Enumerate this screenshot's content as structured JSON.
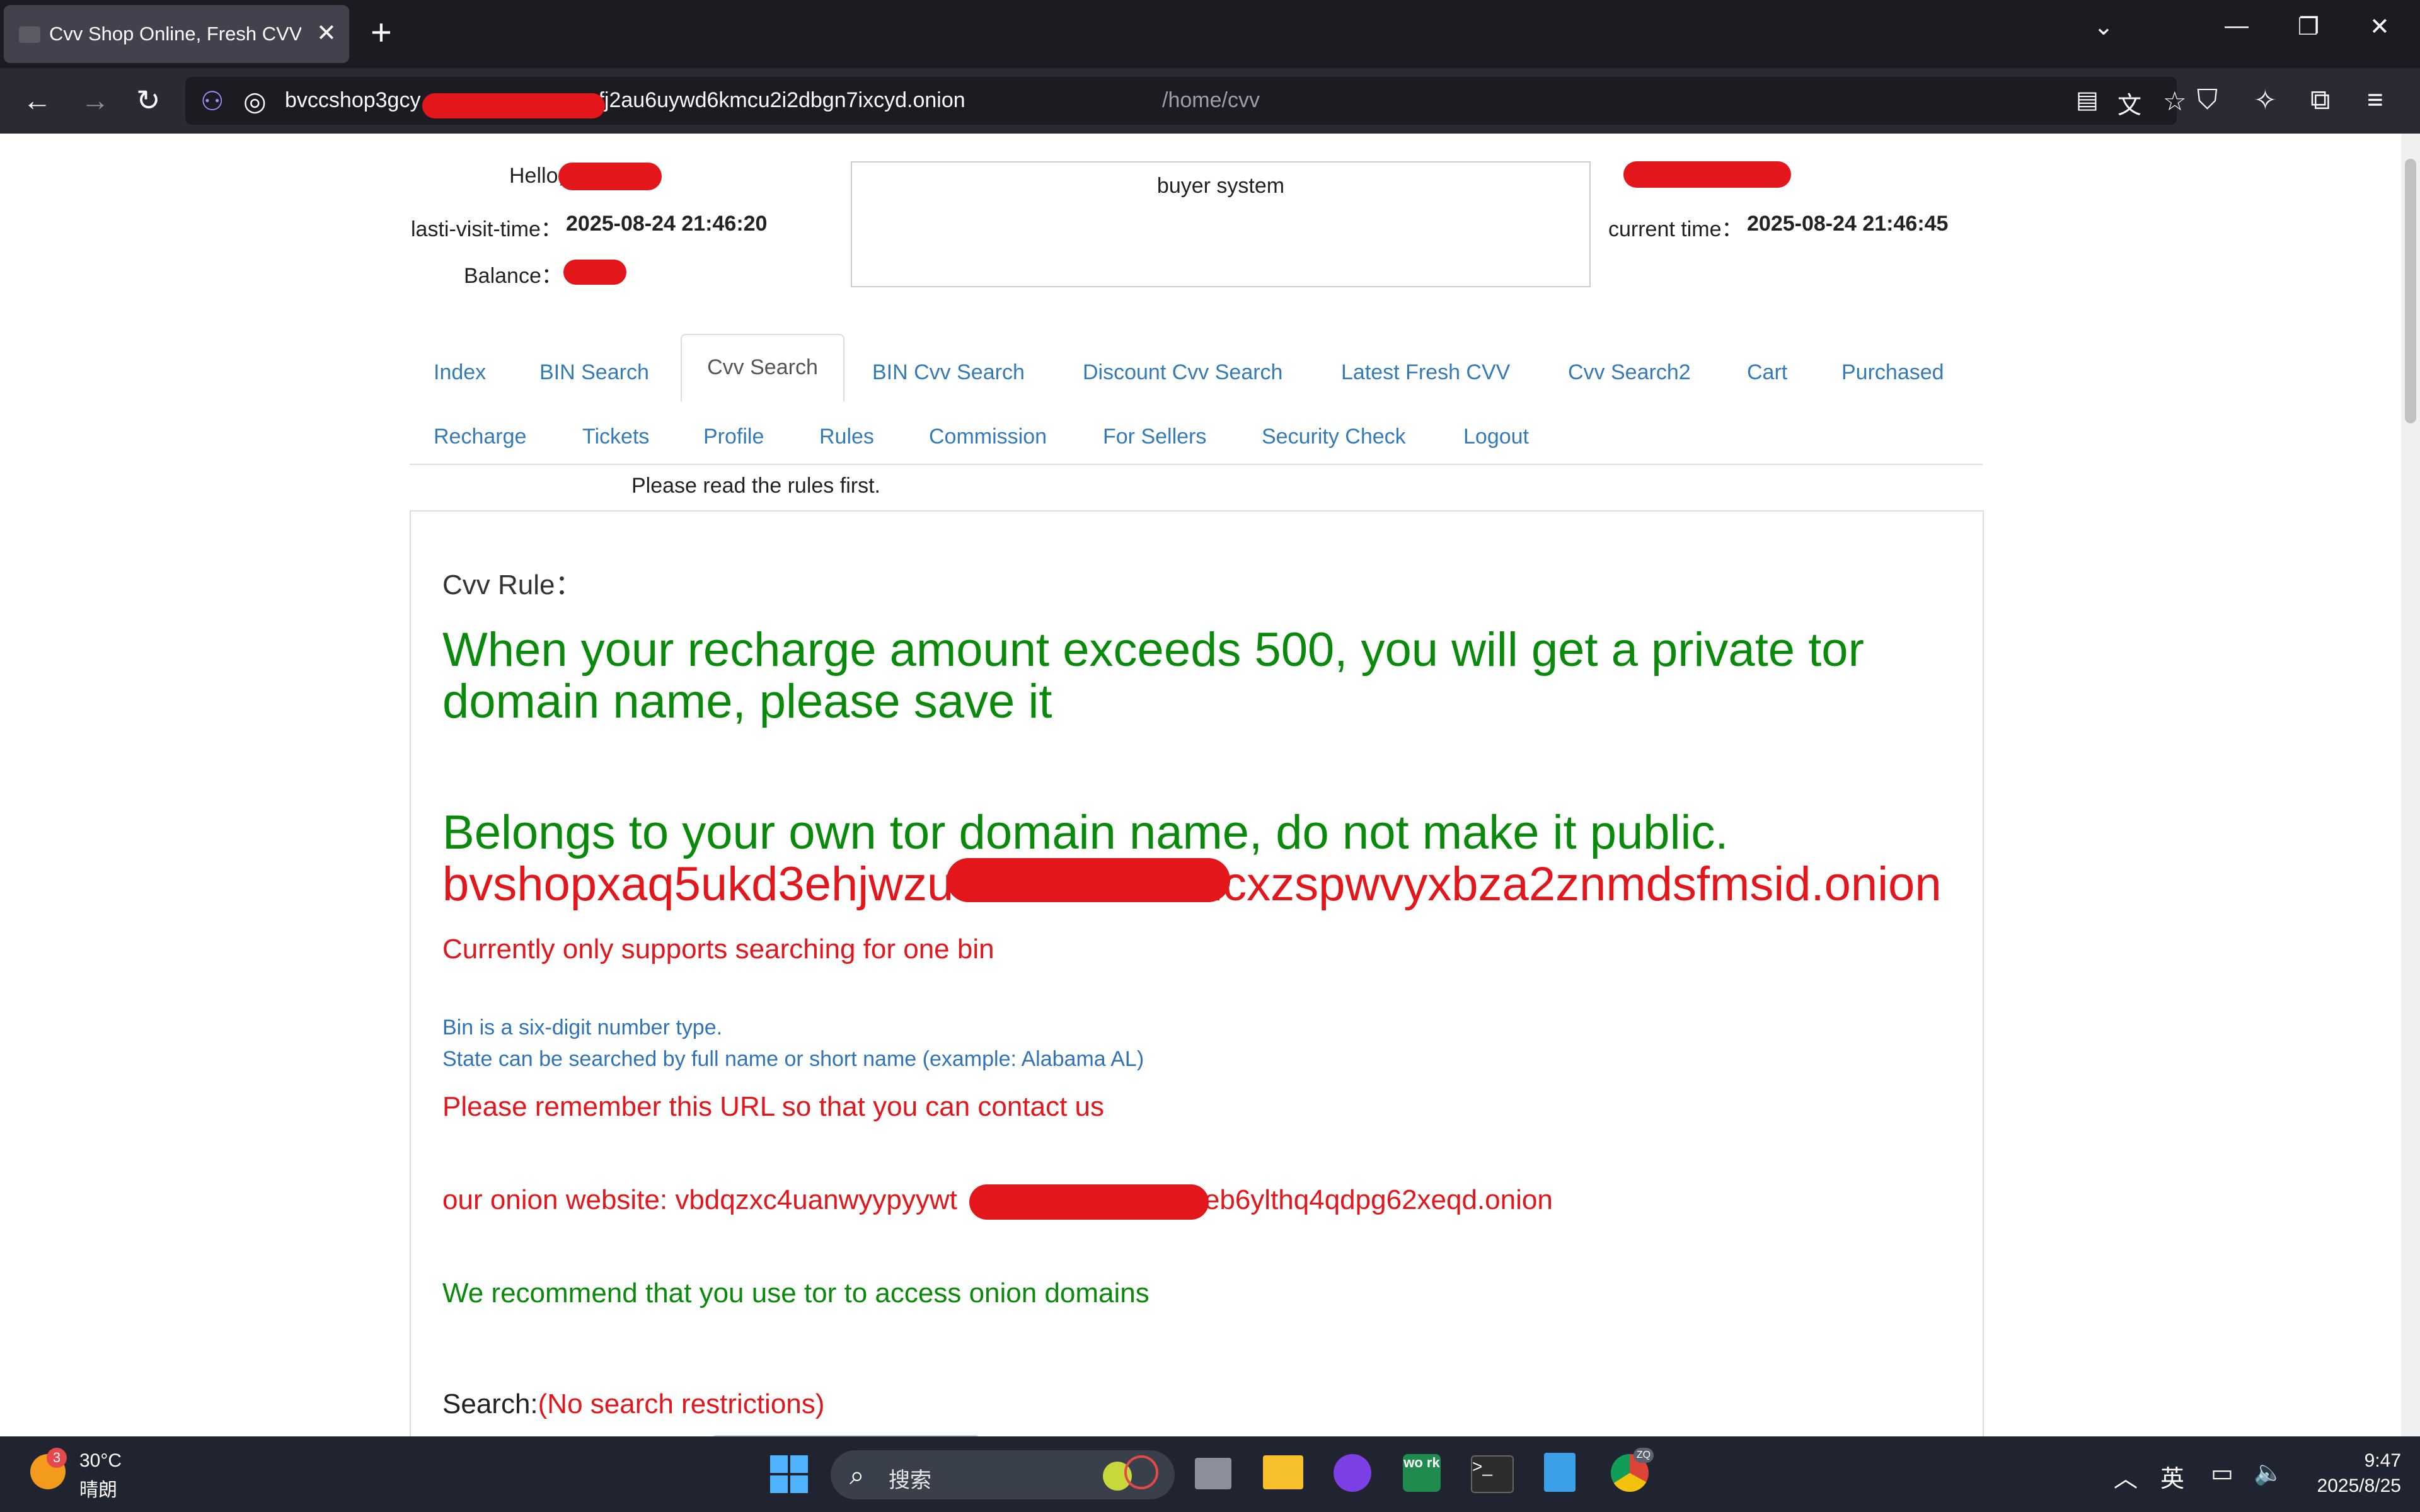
{
  "browser": {
    "tab_title": "Cvv Shop Online, Fresh CVV |",
    "tab_close": "✕",
    "new_tab": "+",
    "url_host_start": "bvccshop3gcy",
    "url_host_end": "vfj2au6uywd6kmcu2i2dbgn7ixcyd.onion",
    "url_path": "/home/cvv",
    "window_controls": {
      "list": "⌄",
      "minimize": "—",
      "restore": "❐",
      "close": "✕"
    }
  },
  "header": {
    "hello_label": "Hello,",
    "last_visit_label": "lasti-visit-time：",
    "last_visit_value": "2025-08-24 21:46:20",
    "balance_label": "Balance：",
    "buyer_system": "buyer system",
    "current_time_label": "current time：",
    "current_time_value": "2025-08-24 21:46:45"
  },
  "nav": {
    "row1": [
      "Index",
      "BIN Search",
      "Cvv Search",
      "BIN Cvv Search",
      "Discount Cvv Search",
      "Latest Fresh CVV",
      "Cvv Search2",
      "Cart",
      "Purchased"
    ],
    "row2": [
      "Recharge",
      "Tickets",
      "Profile",
      "Rules",
      "Commission",
      "For Sellers",
      "Security Check",
      "Logout"
    ],
    "active": "Cvv Search"
  },
  "notice": "Please read the rules first.",
  "content": {
    "rule_label": "Cvv Rule：",
    "recharge_line1": "When your recharge amount exceeds 500, you will get a private tor",
    "recharge_line2": "domain name, please save it",
    "belongs_line": "Belongs to your own tor domain name, do not make it public.",
    "private_domain_start": "bvshopxaq5ukd3ehjwzu",
    "private_domain_end": "lcxzspwvyxbza2znmdsfmsid.onion",
    "one_bin": "Currently only supports searching for one bin",
    "bin_info": "Bin is a six-digit number type.",
    "state_info": "State can be searched by full name or short name (example: Alabama AL)",
    "remember_url": "Please remember this URL so that you can contact us",
    "onion_label": "our onion website: vbdqzxc4uanwyypyywt",
    "onion_end": "keb6ylthq4qdpg62xeqd.onion",
    "recommend_tor": "We recommend that you use tor to access onion domains",
    "search_label": "Search:",
    "search_note": "(No search restrictions)"
  },
  "taskbar": {
    "weather_badge": "3",
    "weather_temp": "30°C",
    "weather_cond": "晴朗",
    "search_placeholder": "搜索",
    "work_label": "wo rk",
    "chrome_badge": "ZQ",
    "ime": "英",
    "time": "9:47",
    "date": "2025/8/25"
  },
  "colors": {
    "green_text": "#0a8a0a",
    "red_text": "#e3161b",
    "link_blue": "#337ab7",
    "chrome_dark": "#1c1b22"
  }
}
